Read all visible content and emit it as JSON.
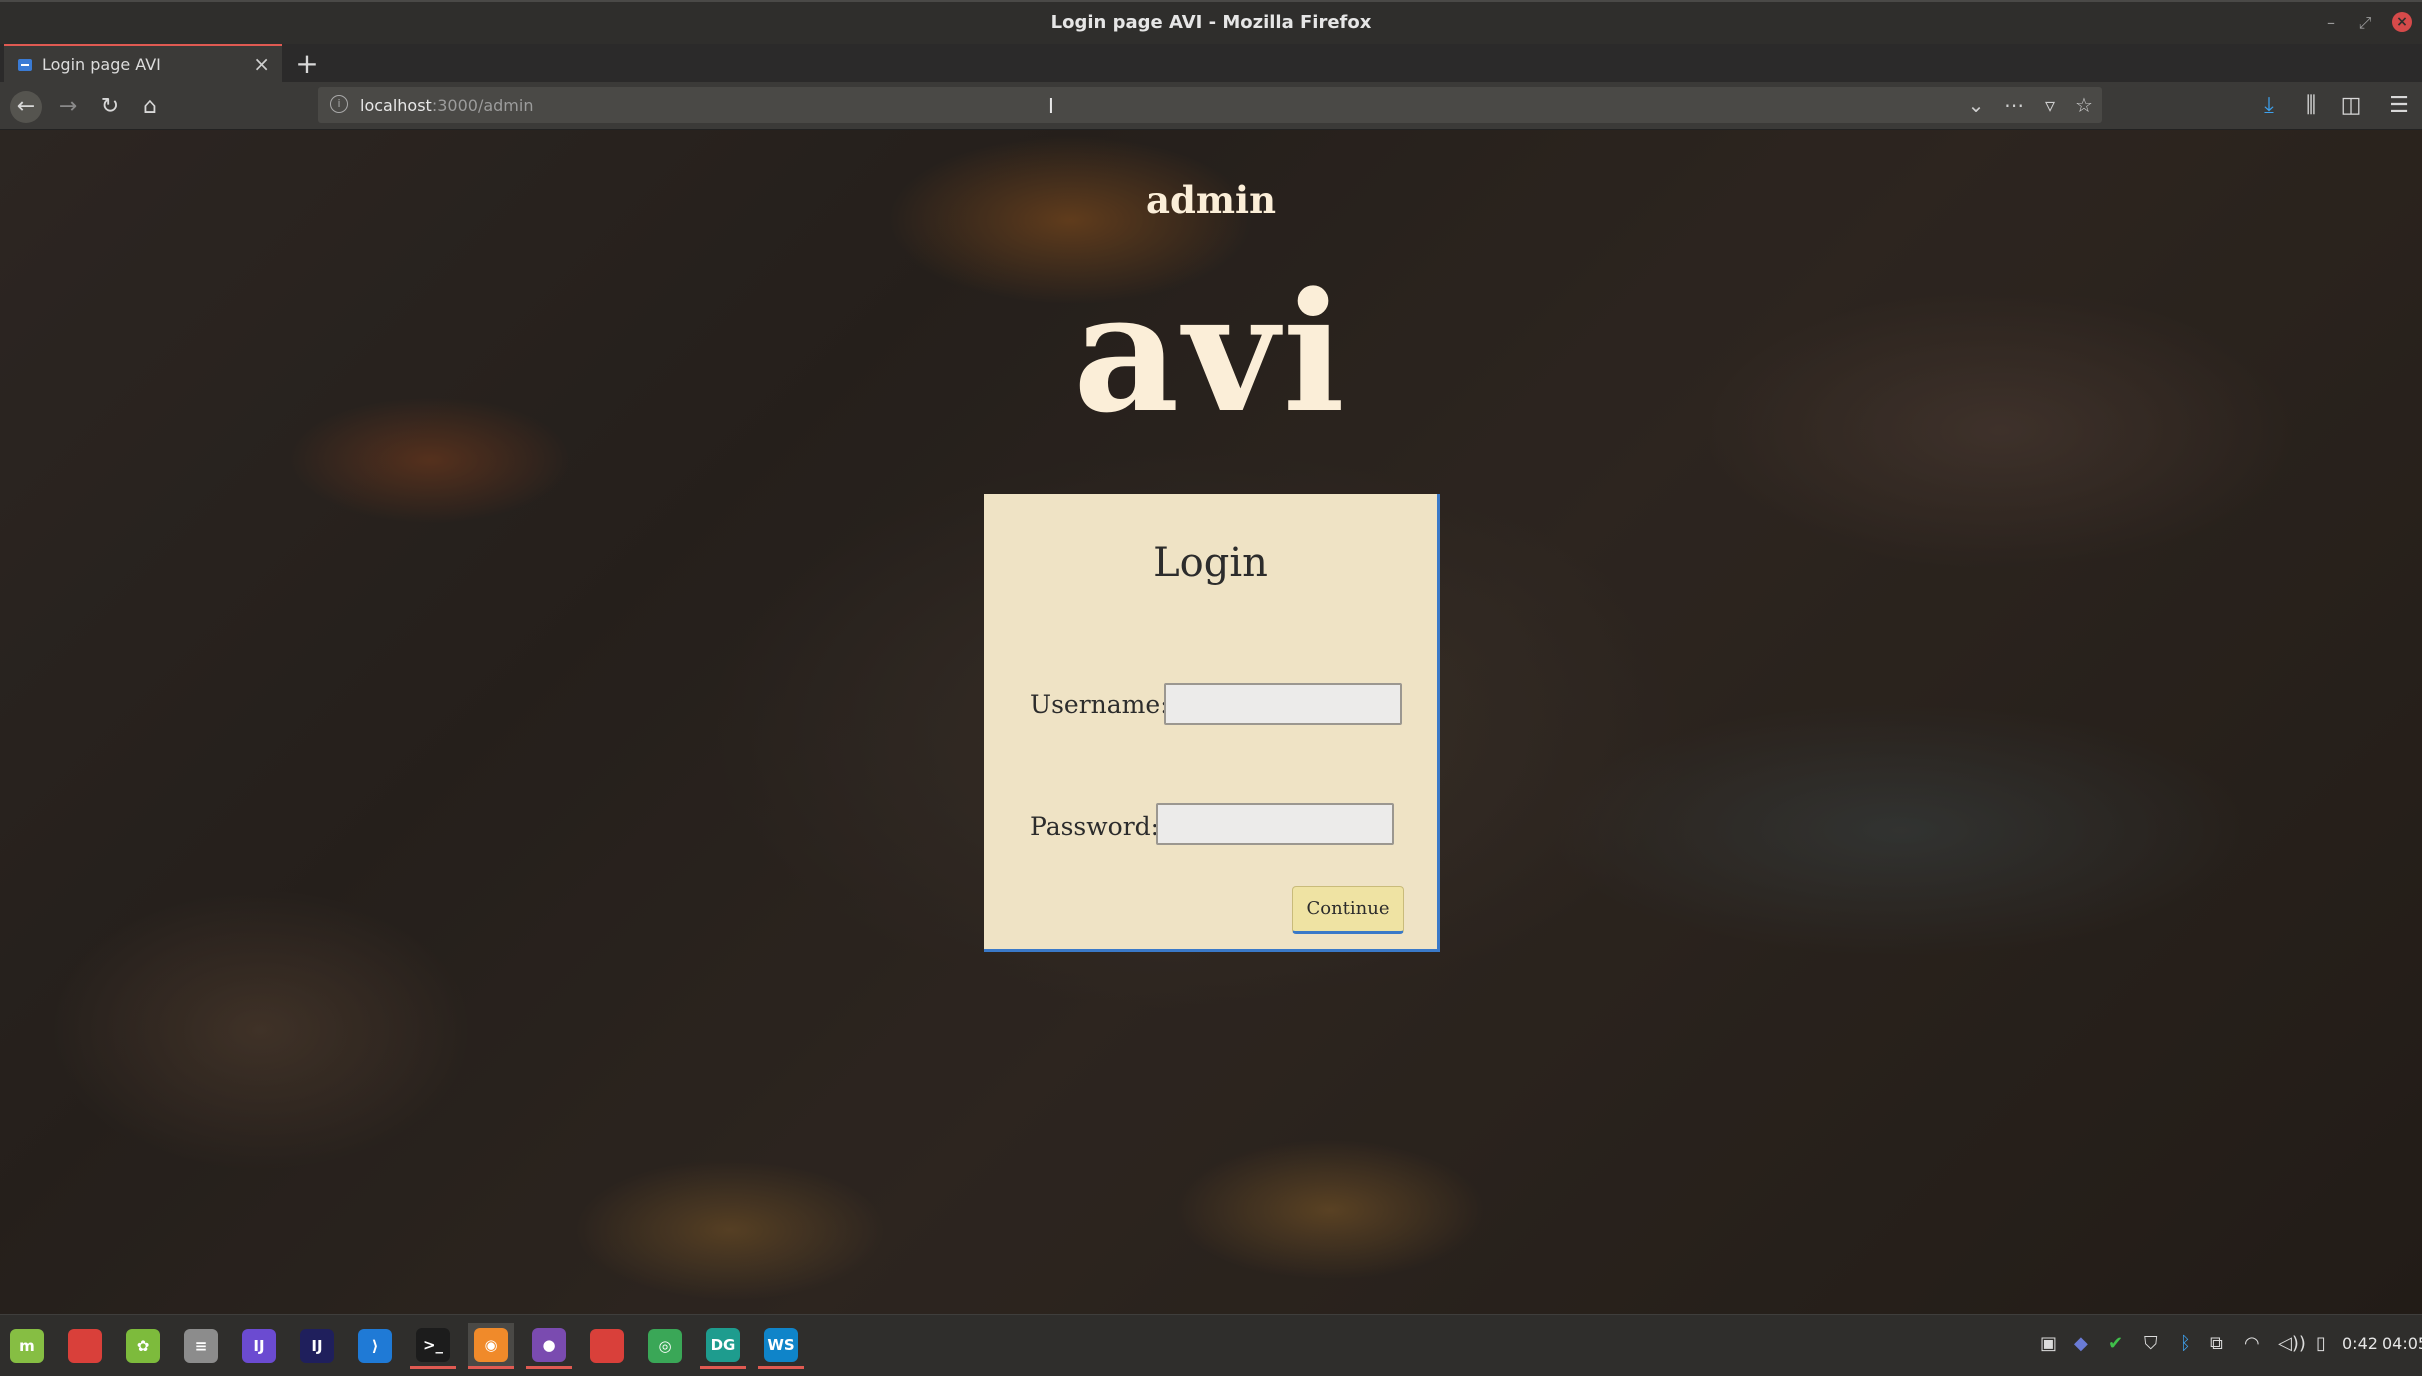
{
  "window": {
    "title": "Login page AVI - Mozilla Firefox"
  },
  "tabs": [
    {
      "label": "Login page AVI",
      "active": true
    }
  ],
  "toolbar": {
    "url_host": "localhost",
    "url_path": ":3000/admin"
  },
  "page": {
    "admin_heading": "admin",
    "brand": "avi",
    "login": {
      "title": "Login",
      "username_label": "Username:",
      "password_label": "Password:",
      "username_value": "",
      "password_value": "",
      "continue_label": "Continue"
    }
  },
  "taskbar": {
    "apps": [
      {
        "name": "mint-menu-icon",
        "glyph": "m",
        "color": "#86be43"
      },
      {
        "name": "folder-red-icon",
        "glyph": "",
        "color": "#d9403a"
      },
      {
        "name": "green-app-icon",
        "glyph": "✿",
        "color": "#7dbb3c"
      },
      {
        "name": "settings-toggle-icon",
        "glyph": "≡",
        "color": "#8c8c8c"
      },
      {
        "name": "intellij-icon",
        "glyph": "IJ",
        "color": "#6b4bd1"
      },
      {
        "name": "intellij-alt-icon",
        "glyph": "IJ",
        "color": "#1f1f5c"
      },
      {
        "name": "vscode-icon",
        "glyph": "⟩",
        "color": "#1f7ad6"
      },
      {
        "name": "terminal-icon",
        "glyph": ">_",
        "color": "#1c1c1c"
      },
      {
        "name": "firefox-icon",
        "glyph": "◉",
        "color": "#f08a2a"
      },
      {
        "name": "github-icon",
        "glyph": "●",
        "color": "#7a4bb0"
      },
      {
        "name": "files-icon",
        "glyph": "",
        "color": "#d9403a"
      },
      {
        "name": "chrome-icon",
        "glyph": "◎",
        "color": "#3aa757"
      },
      {
        "name": "datagrip-icon",
        "glyph": "DG",
        "color": "#1e9c8e"
      },
      {
        "name": "webstorm-icon",
        "glyph": "WS",
        "color": "#0f84c9"
      }
    ],
    "time": "0:42",
    "clock": "04:05"
  }
}
